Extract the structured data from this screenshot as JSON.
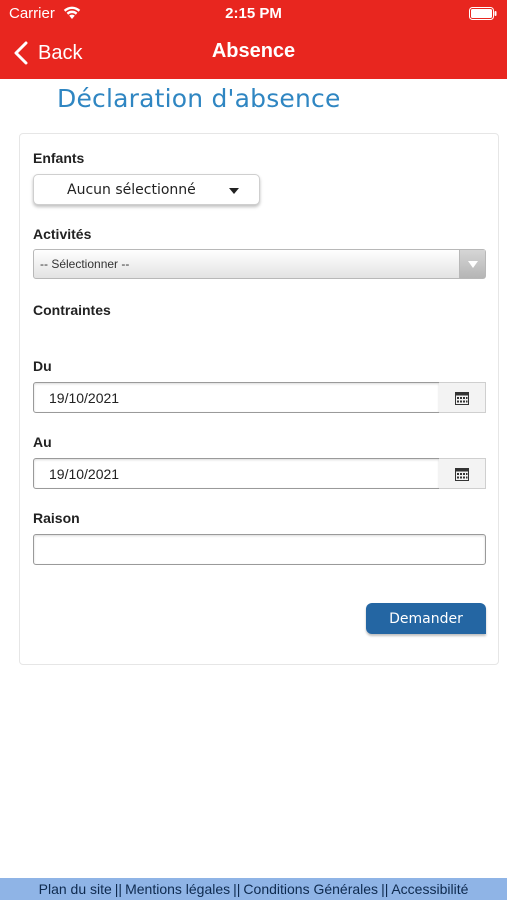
{
  "status_bar": {
    "carrier": "Carrier",
    "time": "2:15 PM"
  },
  "nav": {
    "back_label": "Back",
    "title": "Absence"
  },
  "page": {
    "title": "Déclaration d'absence"
  },
  "form": {
    "children": {
      "label": "Enfants",
      "selected": "Aucun sélectionné"
    },
    "activities": {
      "label": "Activités",
      "selected": "-- Sélectionner --"
    },
    "constraints": {
      "label": "Contraintes"
    },
    "from": {
      "label": "Du",
      "value": "19/10/2021"
    },
    "to": {
      "label": "Au",
      "value": "19/10/2021"
    },
    "reason": {
      "label": "Raison",
      "value": ""
    },
    "submit_label": "Demander"
  },
  "footer": {
    "links": [
      "Plan du site",
      "Mentions légales",
      "Conditions Générales",
      "Accessibilité"
    ],
    "separator": "||"
  },
  "colors": {
    "header_red": "#e8261f",
    "title_blue": "#2f86c2",
    "button_blue": "#2466a3",
    "footer_blue": "#8fb4e6"
  },
  "icons": [
    "wifi-icon",
    "battery-icon",
    "back-chevron-icon",
    "caret-down-icon",
    "calendar-icon"
  ]
}
